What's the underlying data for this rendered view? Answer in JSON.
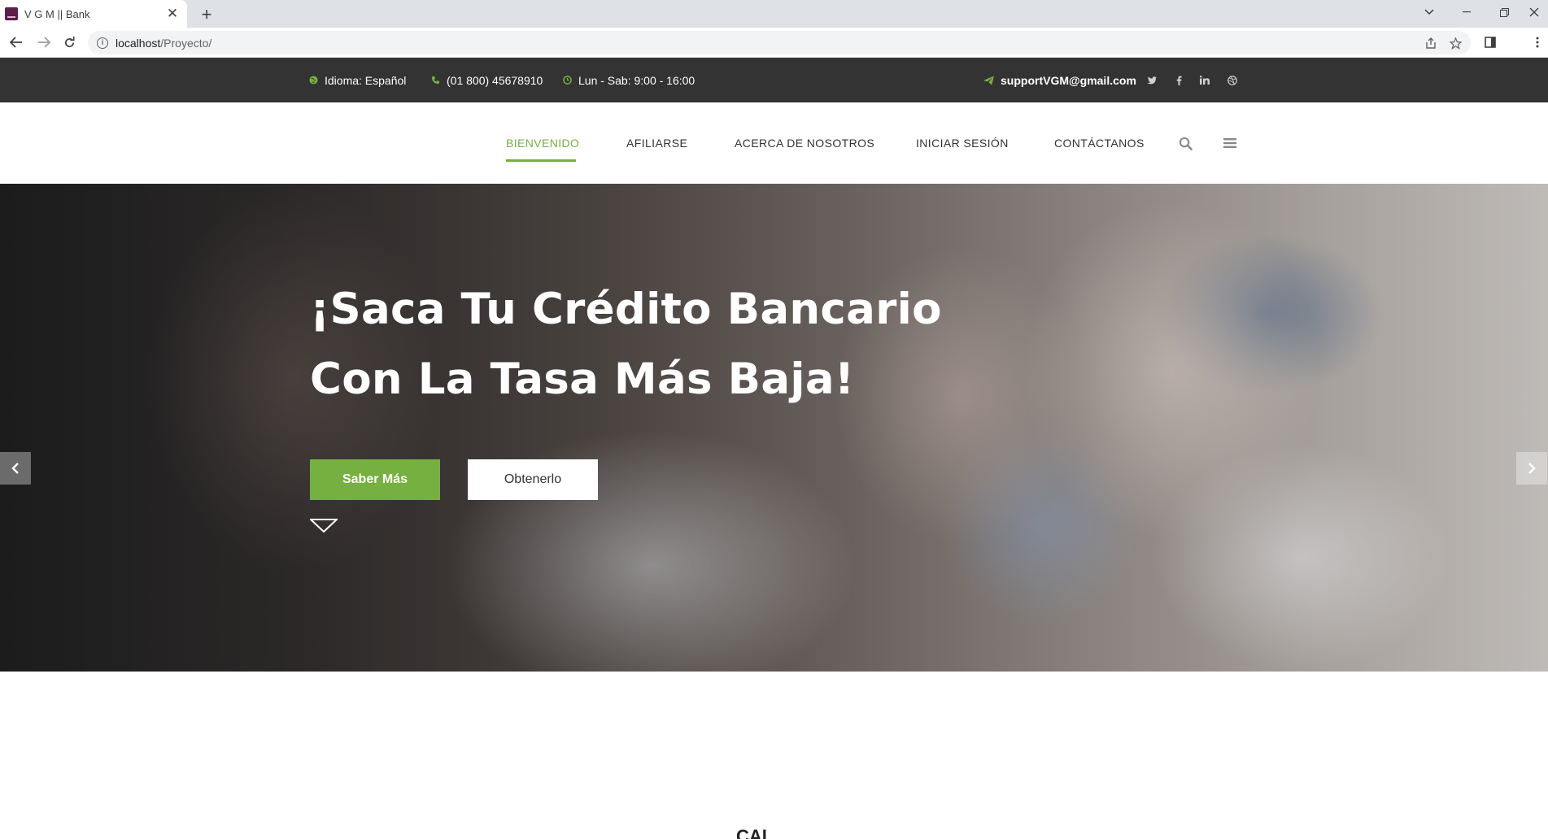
{
  "browser": {
    "tab_title": "V G M || Bank",
    "tab_close": "✕",
    "new_tab": "+",
    "url_host": "localhost",
    "url_path": "/Proyecto/",
    "window_controls": [
      "chevron-down-icon",
      "minimize-icon",
      "restore-icon",
      "close-icon"
    ]
  },
  "topbar": {
    "language": "Idioma: Español",
    "phone": "(01 800) 45678910",
    "hours": "Lun - Sab: 9:00 - 16:00",
    "email": "supportVGM@gmail.com",
    "social": [
      "twitter-icon",
      "facebook-icon",
      "linkedin-icon",
      "dribbble-icon"
    ],
    "accent_color": "#76b041"
  },
  "nav": {
    "items": [
      {
        "label": "BIENVENIDO",
        "active": true
      },
      {
        "label": "AFILIARSE",
        "active": false
      },
      {
        "label": "ACERCA DE NOSOTROS",
        "active": false
      },
      {
        "label": "INICIAR SESIÓN",
        "active": false
      },
      {
        "label": "CONTÁCTANOS",
        "active": false
      }
    ],
    "icons": [
      "search-icon",
      "menu-icon"
    ]
  },
  "hero": {
    "title_line1": "¡Saca Tu Crédito Bancario",
    "title_line2": "Con La Tasa Más Baja!",
    "primary_button": "Saber Más",
    "secondary_button": "Obtenerlo",
    "primary_color": "#76b041"
  },
  "below": {
    "heading_partial": "CAL"
  }
}
